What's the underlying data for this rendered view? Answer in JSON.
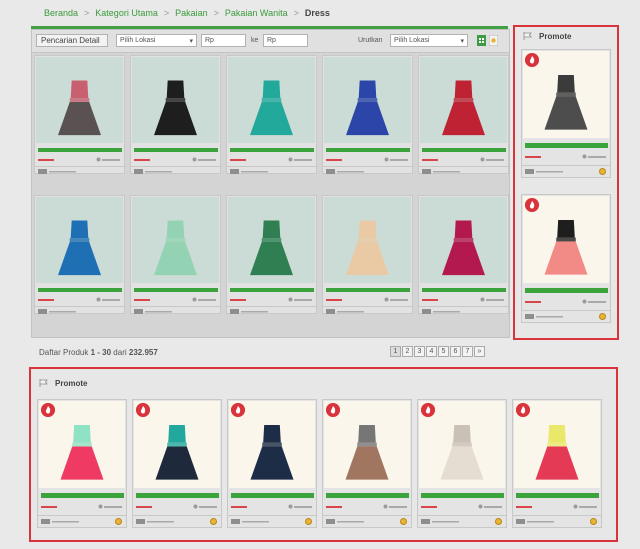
{
  "breadcrumb": {
    "items": [
      "Beranda",
      "Kategori Utama",
      "Pakaian",
      "Pakaian Wanita"
    ],
    "separator": ">",
    "current": "Dress"
  },
  "filter": {
    "search_detail": "Pencarian Detail",
    "location": "Pilih Lokasi",
    "price_min_placeholder": "Rp",
    "to_label": "ke",
    "price_max_placeholder": "Rp",
    "sort_label": "Urutkan",
    "sort_value": "Pilih Lokasi"
  },
  "colors": {
    "accent_green": "#44a047",
    "promo_red": "#d9343c"
  },
  "products": [
    {
      "icon": "dress-pink-grey-icon",
      "top": "#c86070",
      "skirt": "#5a5152",
      "bg": "#cbdcd6"
    },
    {
      "icon": "dress-black-icon",
      "top": "#1e1e1e",
      "skirt": "#1e1e1e",
      "bg": "#cbdcd6"
    },
    {
      "icon": "dress-teal-icon",
      "top": "#22a99c",
      "skirt": "#22a99c",
      "bg": "#cbdcd6"
    },
    {
      "icon": "dress-blue-icon",
      "top": "#2b45a8",
      "skirt": "#2b45a8",
      "bg": "#cbdcd6"
    },
    {
      "icon": "dress-red-icon",
      "top": "#bf2233",
      "skirt": "#bf2233",
      "bg": "#cbdcd6"
    },
    {
      "icon": "dress-navy-blue-icon",
      "top": "#1e6fb4",
      "skirt": "#1e6fb4",
      "bg": "#cbdcd6"
    },
    {
      "icon": "dress-mint-icon",
      "top": "#93d3b4",
      "skirt": "#93d3b4",
      "bg": "#cbdcd6"
    },
    {
      "icon": "dress-green-icon",
      "top": "#2f7f52",
      "skirt": "#2f7f52",
      "bg": "#cbdcd6"
    },
    {
      "icon": "dress-beige-icon",
      "top": "#e9caa4",
      "skirt": "#e9caa4",
      "bg": "#cbdcd6"
    },
    {
      "icon": "dress-magenta-icon",
      "top": "#b3194f",
      "skirt": "#b3194f",
      "bg": "#cbdcd6"
    }
  ],
  "listing": {
    "prefix": "Daftar Produk",
    "range": "1 - 30",
    "middle": "dari",
    "total": "232.957"
  },
  "pagination": [
    "1",
    "2",
    "3",
    "4",
    "5",
    "6",
    "7",
    "»"
  ],
  "side_promote": {
    "title": "Promote",
    "items": [
      {
        "icon": "dress-grey-bow-icon",
        "top": "#3b3b3b",
        "skirt": "#4d4d4d"
      },
      {
        "icon": "dress-coral-black-icon",
        "top": "#1e1e1e",
        "skirt": "#f28a85"
      }
    ]
  },
  "bottom_promote": {
    "title": "Promote",
    "items": [
      {
        "icon": "dress-mint-pink-icon",
        "top": "#8fe2c3",
        "skirt": "#ef3b63"
      },
      {
        "icon": "dress-teal-navy-icon",
        "top": "#23a89e",
        "skirt": "#1e2a3c"
      },
      {
        "icon": "dress-navy-pink-icon",
        "top": "#1d2d48",
        "skirt": "#1d2d48"
      },
      {
        "icon": "dress-brown-icon",
        "top": "#767676",
        "skirt": "#a07660"
      },
      {
        "icon": "dress-cream-icon",
        "top": "#c9c0b6",
        "skirt": "#e6ddd2"
      },
      {
        "icon": "dress-yellow-red-icon",
        "top": "#e9e86a",
        "skirt": "#e43a55"
      }
    ]
  }
}
